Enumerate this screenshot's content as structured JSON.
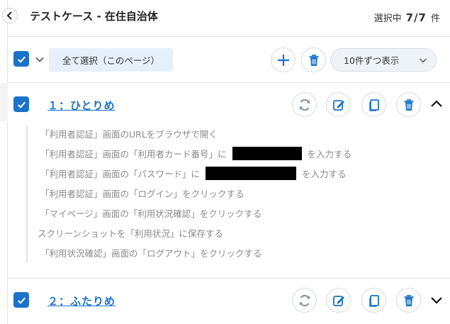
{
  "header": {
    "title": "テストケース - 在住自治体",
    "selection_label": "選択中",
    "selection_count": "7/7",
    "selection_unit": "件"
  },
  "toolbar": {
    "select_all_label": "全て選択（このページ）",
    "per_page_label": "10件ずつ表示",
    "icons": [
      "check-icon",
      "chevron-down-icon",
      "plus-icon",
      "trash-icon"
    ]
  },
  "cases": [
    {
      "title": "１：ひとりめ",
      "expanded": true,
      "steps": [
        {
          "text": "「利用者認証」画面のURLをブラウザで開く"
        },
        {
          "before": "「利用者認証」画面の「利用者カード番号」に",
          "after": "を入力する"
        },
        {
          "before": "「利用者認証」画面の「パスワード」に",
          "after": "を入力する"
        },
        {
          "text": "「利用者認証」画面の「ログイン」をクリックする"
        },
        {
          "text": "「マイページ」画面の「利用状況確認」をクリックする"
        },
        {
          "text": "スクリーンショットを「利用状況」に保存する"
        },
        {
          "text": "「利用状況確認」画面の「ログアウト」をクリックする"
        }
      ]
    },
    {
      "title": "２：ふたりめ",
      "expanded": false
    }
  ],
  "colors": {
    "accent": "#1a73c9",
    "trash": "#1a73c9",
    "refresh": "#8d98a3"
  }
}
